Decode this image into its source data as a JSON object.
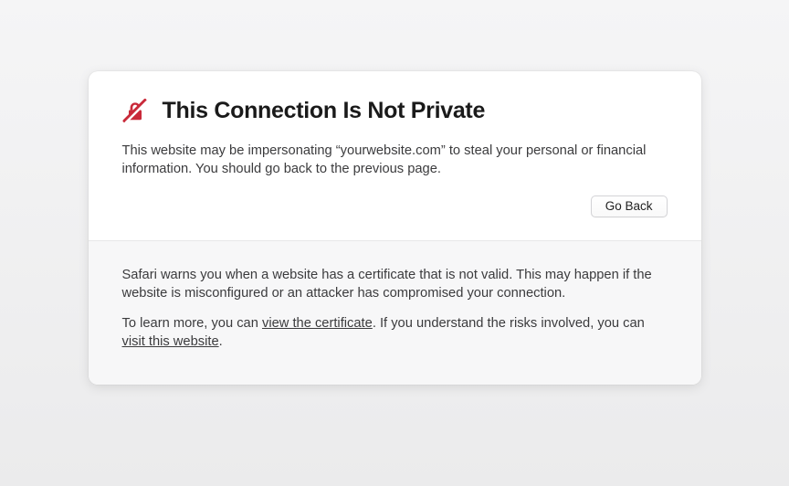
{
  "header": {
    "title": "This Connection Is Not Private",
    "icon_name": "insecure-lock-icon"
  },
  "description": "This website may be impersonating “yourwebsite.com” to steal your personal or financial information. You should go back to the previous page.",
  "buttons": {
    "go_back": "Go Back"
  },
  "details": {
    "warning_text": "Safari warns you when a website has a certificate that is not valid. This may happen if the website is misconfigured or an attacker has compromised your connection.",
    "learn_prefix": "To learn more, you can ",
    "view_certificate": "view the certificate",
    "risks_middle": ". If you understand the risks involved, you can ",
    "visit_website": "visit this website",
    "suffix": "."
  },
  "colors": {
    "accent_red": "#c92a3a"
  }
}
